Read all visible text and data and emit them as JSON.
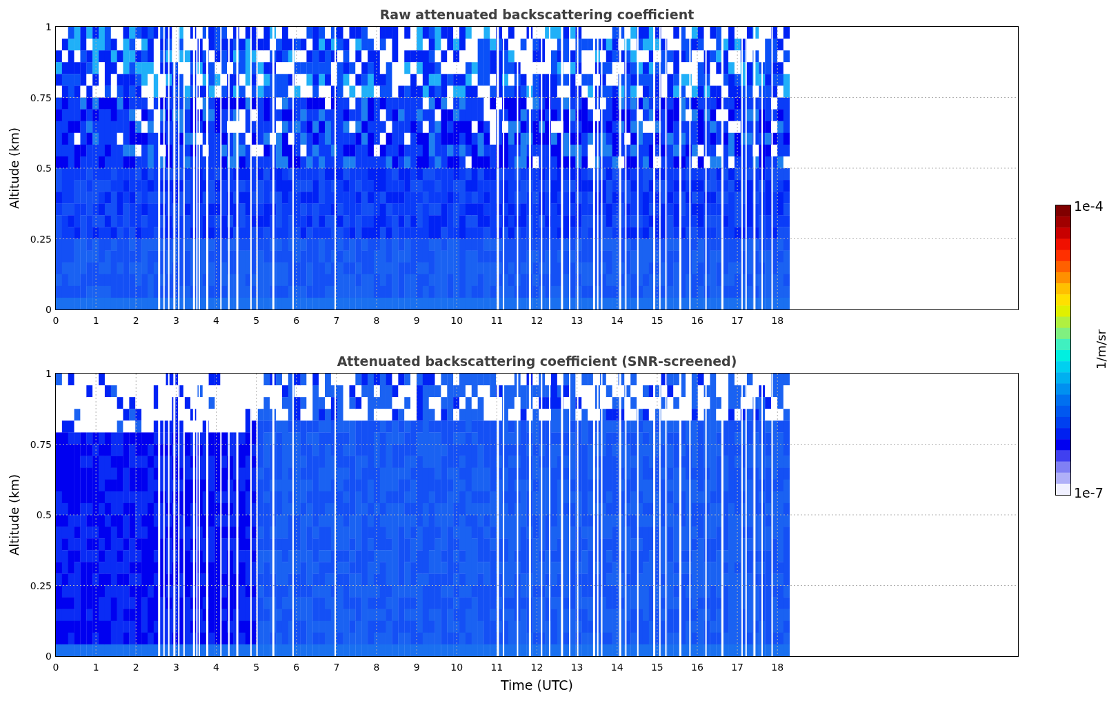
{
  "panels": [
    {
      "title": "Raw attenuated backscattering coefficient",
      "ylabel": "Altitude (km)",
      "yticks": [
        "1",
        "0.75",
        "0.5",
        "0.25",
        "0"
      ],
      "xticks": [
        "0",
        "1",
        "2",
        "3",
        "4",
        "5",
        "6",
        "7",
        "8",
        "9",
        "10",
        "11",
        "12",
        "13",
        "14",
        "15",
        "16",
        "17",
        "18"
      ],
      "kind": "raw"
    },
    {
      "title": "Attenuated backscattering coefficient (SNR-screened)",
      "ylabel": "Altitude (km)",
      "yticks": [
        "1",
        "0.75",
        "0.5",
        "0.25",
        "0"
      ],
      "xticks": [
        "0",
        "1",
        "2",
        "3",
        "4",
        "5",
        "6",
        "7",
        "8",
        "9",
        "10",
        "11",
        "12",
        "13",
        "14",
        "15",
        "16",
        "17",
        "18"
      ],
      "kind": "screened"
    }
  ],
  "xlabel": "Time (UTC)",
  "colorbar": {
    "max": "1e-4",
    "min": "1e-7",
    "label": "1/m/sr"
  }
}
